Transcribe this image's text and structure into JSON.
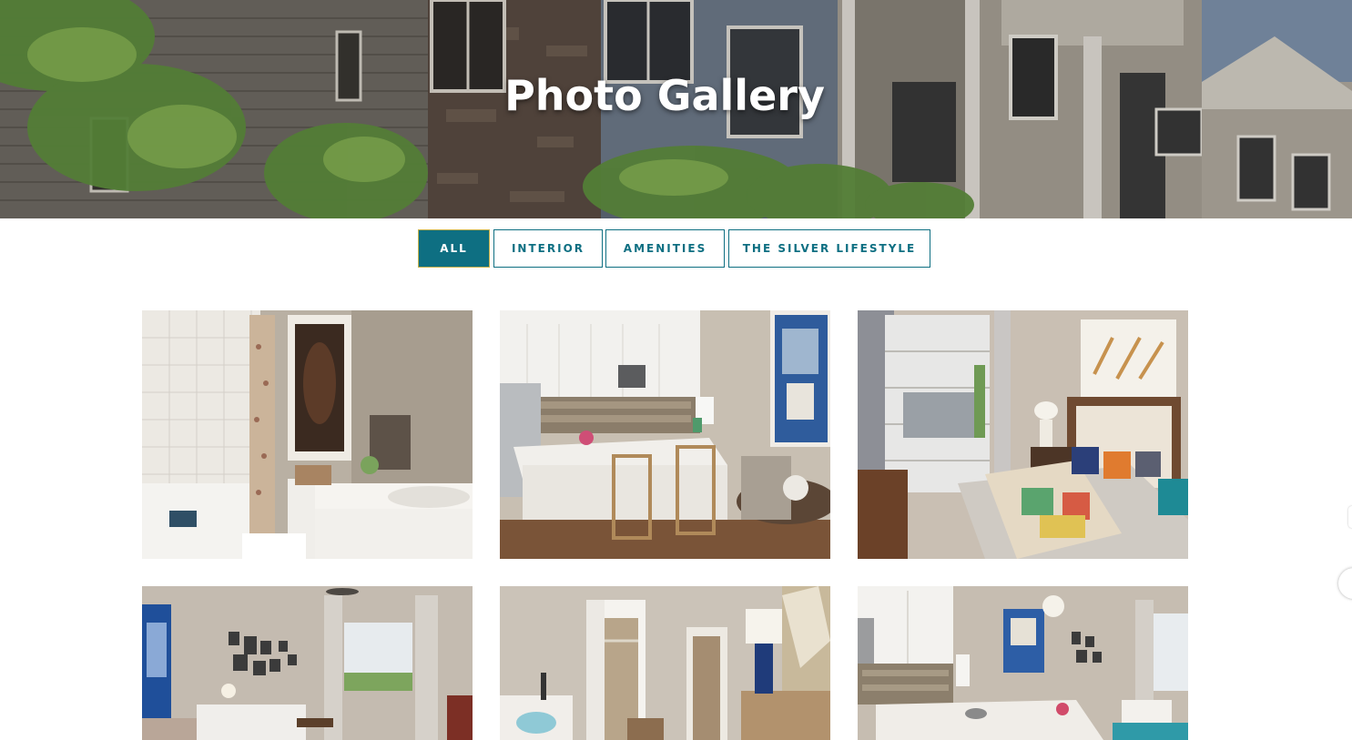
{
  "hero": {
    "title": "Photo Gallery",
    "image": "apartment-building-exterior"
  },
  "filters": [
    {
      "label": "ALL",
      "active": true
    },
    {
      "label": "INTERIOR",
      "active": false
    },
    {
      "label": "AMENITIES",
      "active": false
    },
    {
      "label": "THE SILVER LIFESTYLE",
      "active": false
    }
  ],
  "gallery": [
    {
      "image": "bathroom-with-horse-painting"
    },
    {
      "image": "kitchen-with-bar-stools"
    },
    {
      "image": "bedroom-with-colorful-bedding"
    },
    {
      "image": "living-room-with-gallery-wall"
    },
    {
      "image": "bedroom-with-walk-in-closet"
    },
    {
      "image": "open-kitchen-and-living-area"
    }
  ],
  "colors": {
    "accent": "#0e6f82",
    "active_border": "#c9b24a"
  }
}
